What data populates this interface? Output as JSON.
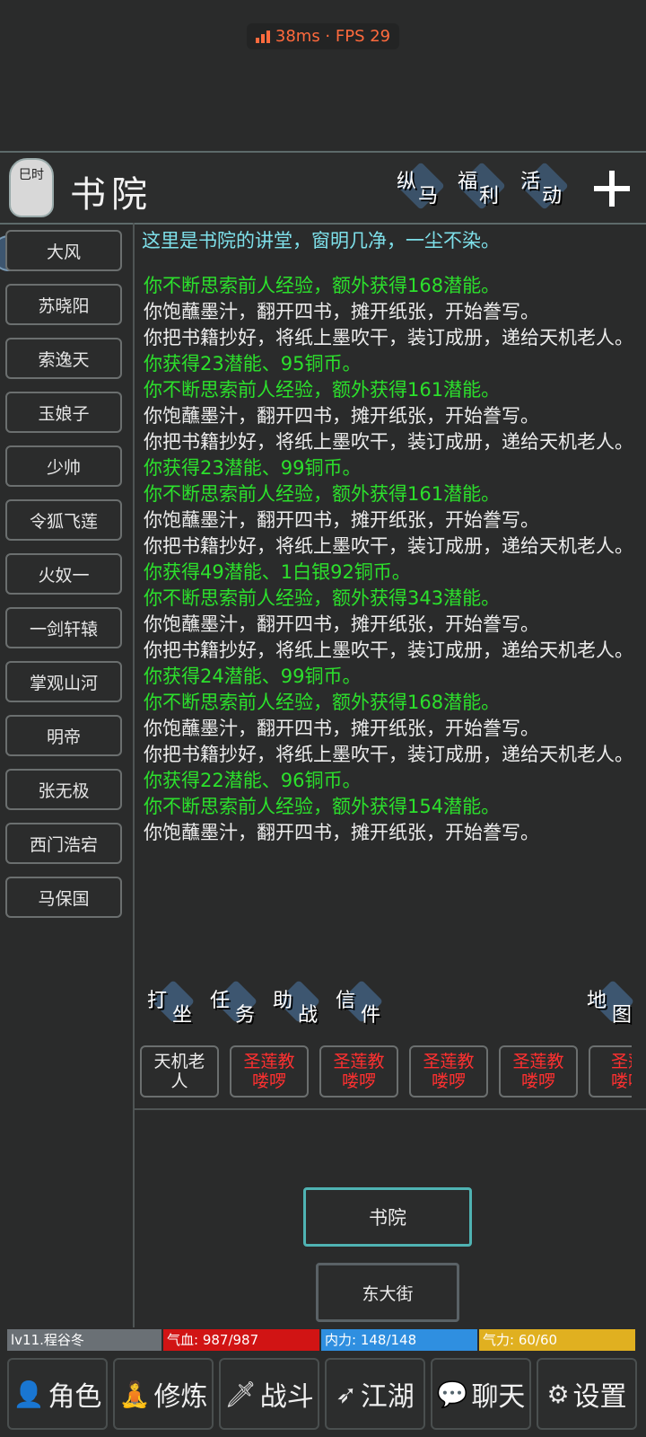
{
  "status": {
    "perf_text": "38ms · FPS 29"
  },
  "header": {
    "lantern_text": "巳时",
    "title": "书院",
    "buttons": [
      {
        "a": "纵",
        "b": "马"
      },
      {
        "a": "福",
        "b": "利"
      },
      {
        "a": "活",
        "b": "动"
      }
    ]
  },
  "npcs": [
    "大风",
    "苏晓阳",
    "索逸天",
    "玉娘子",
    "少帅",
    "令狐飞莲",
    "火奴一",
    "一剑轩辕",
    "掌观山河",
    "明帝",
    "张无极",
    "西门浩宕",
    "马保国"
  ],
  "description": "这里是书院的讲堂，窗明几净，一尘不染。",
  "log": [
    {
      "color": "green",
      "text": "你不断思索前人经验，额外获得168潜能。"
    },
    {
      "color": "white",
      "text": "你饱蘸墨汁，翻开四书，摊开纸张，开始誊写。"
    },
    {
      "color": "white",
      "text": "你把书籍抄好，将纸上墨吹干，装订成册，递给天机老人。"
    },
    {
      "color": "green",
      "text": "你获得23潜能、95铜币。"
    },
    {
      "color": "green",
      "text": "你不断思索前人经验，额外获得161潜能。"
    },
    {
      "color": "white",
      "text": "你饱蘸墨汁，翻开四书，摊开纸张，开始誊写。"
    },
    {
      "color": "white",
      "text": "你把书籍抄好，将纸上墨吹干，装订成册，递给天机老人。"
    },
    {
      "color": "green",
      "text": "你获得23潜能、99铜币。"
    },
    {
      "color": "green",
      "text": "你不断思索前人经验，额外获得161潜能。"
    },
    {
      "color": "white",
      "text": "你饱蘸墨汁，翻开四书，摊开纸张，开始誊写。"
    },
    {
      "color": "white",
      "text": "你把书籍抄好，将纸上墨吹干，装订成册，递给天机老人。"
    },
    {
      "color": "green",
      "text": "你获得49潜能、1白银92铜币。"
    },
    {
      "color": "green",
      "text": "你不断思索前人经验，额外获得343潜能。"
    },
    {
      "color": "white",
      "text": "你饱蘸墨汁，翻开四书，摊开纸张，开始誊写。"
    },
    {
      "color": "white",
      "text": "你把书籍抄好，将纸上墨吹干，装订成册，递给天机老人。"
    },
    {
      "color": "green",
      "text": "你获得24潜能、99铜币。"
    },
    {
      "color": "green",
      "text": "你不断思索前人经验，额外获得168潜能。"
    },
    {
      "color": "white",
      "text": "你饱蘸墨汁，翻开四书，摊开纸张，开始誊写。"
    },
    {
      "color": "white",
      "text": "你把书籍抄好，将纸上墨吹干，装订成册，递给天机老人。"
    },
    {
      "color": "green",
      "text": "你获得22潜能、96铜币。"
    },
    {
      "color": "green",
      "text": "你不断思索前人经验，额外获得154潜能。"
    },
    {
      "color": "white",
      "text": "你饱蘸墨汁，翻开四书，摊开纸张，开始誊写。"
    }
  ],
  "actions": [
    {
      "a": "打",
      "b": "坐"
    },
    {
      "a": "任",
      "b": "务"
    },
    {
      "a": "助",
      "b": "战"
    },
    {
      "a": "信",
      "b": "件"
    },
    {
      "a": "地",
      "b": "图"
    }
  ],
  "people": [
    {
      "l1": "天机老",
      "l2": "人",
      "color": "white"
    },
    {
      "l1": "圣莲教",
      "l2": "喽啰",
      "color": "red"
    },
    {
      "l1": "圣莲教",
      "l2": "喽啰",
      "color": "red"
    },
    {
      "l1": "圣莲教",
      "l2": "喽啰",
      "color": "red"
    },
    {
      "l1": "圣莲教",
      "l2": "喽啰",
      "color": "red"
    },
    {
      "l1": "圣莲",
      "l2": "喽啰",
      "color": "red"
    }
  ],
  "locations": {
    "current": "书院",
    "exit": "东大街"
  },
  "stats": {
    "level": "lv11.程谷冬",
    "hp": "气血: 987/987",
    "mp": "内力: 148/148",
    "sp": "气力: 60/60"
  },
  "nav": [
    {
      "label": "角色",
      "icon": "person-icon",
      "glyph": "👤"
    },
    {
      "label": "修炼",
      "icon": "meditate-icon",
      "glyph": "🧘"
    },
    {
      "label": "战斗",
      "icon": "sword-icon",
      "glyph": "🗡"
    },
    {
      "label": "江湖",
      "icon": "world-icon",
      "glyph": "➶"
    },
    {
      "label": "聊天",
      "icon": "chat-icon",
      "glyph": "💬"
    },
    {
      "label": "设置",
      "icon": "gear-icon",
      "glyph": "⚙"
    }
  ]
}
